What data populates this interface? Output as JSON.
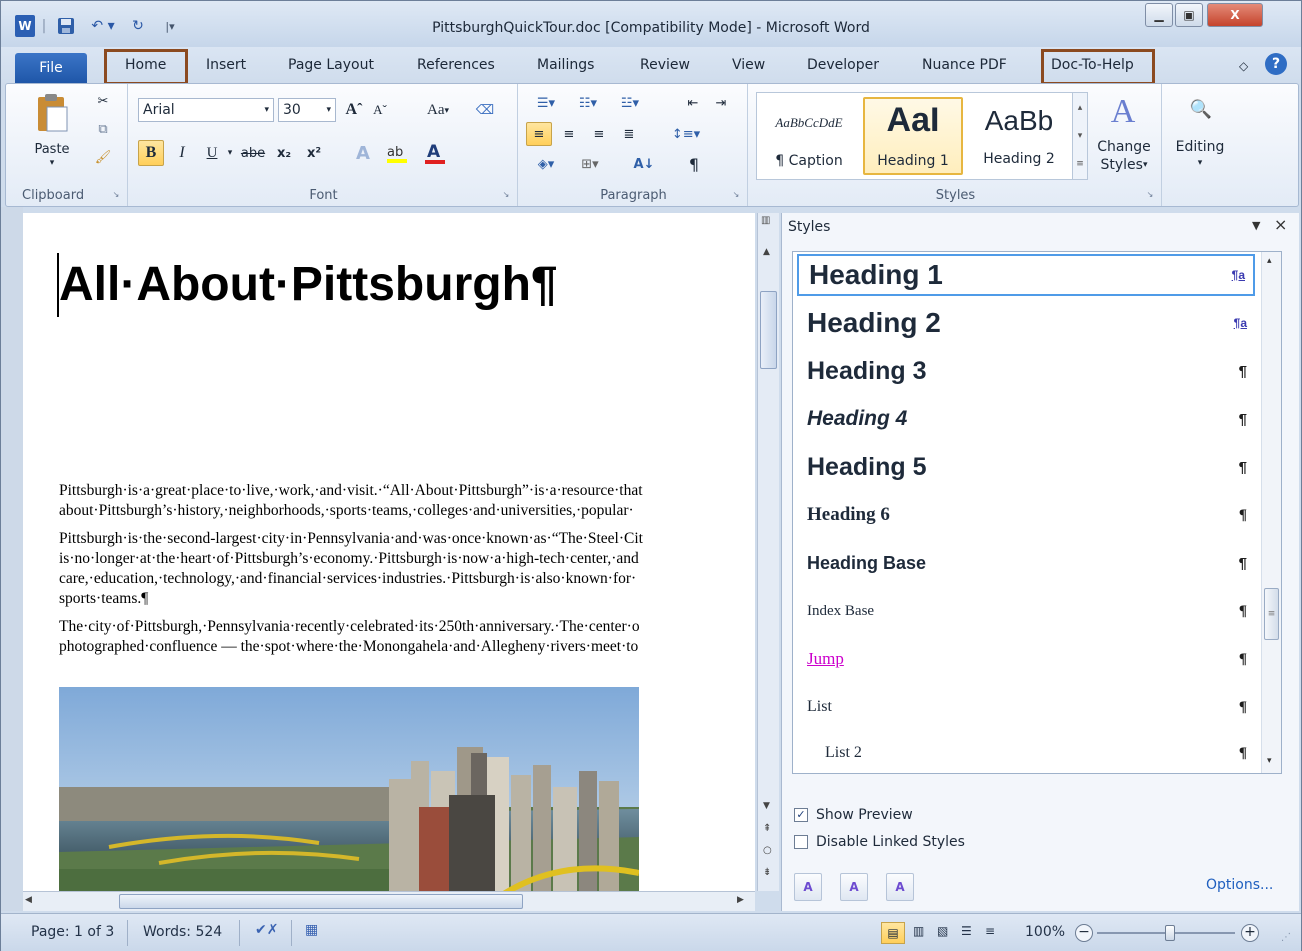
{
  "window": {
    "title": "PittsburghQuickTour.doc [Compatibility Mode] - Microsoft Word",
    "app_badge": "W"
  },
  "tabs": {
    "file": "File",
    "home": "Home",
    "insert": "Insert",
    "page_layout": "Page Layout",
    "references": "References",
    "mailings": "Mailings",
    "review": "Review",
    "view": "View",
    "developer": "Developer",
    "nuance_pdf": "Nuance PDF",
    "doc_to_help": "Doc-To-Help"
  },
  "ribbon": {
    "clipboard": {
      "label": "Clipboard",
      "paste": "Paste"
    },
    "font": {
      "label": "Font",
      "name": "Arial",
      "size": "30",
      "case": "Aa",
      "bold": "B",
      "italic": "I",
      "underline": "U",
      "strike": "abe",
      "subscript": "x₂",
      "superscript": "x²"
    },
    "paragraph": {
      "label": "Paragraph",
      "pilcrow": "¶"
    },
    "styles": {
      "label": "Styles",
      "gallery": [
        {
          "preview": "AaBbCcDdE",
          "name": "¶ Caption"
        },
        {
          "preview": "AaI",
          "name": "Heading 1"
        },
        {
          "preview": "AaBb",
          "name": "Heading 2"
        }
      ],
      "change_styles_1": "Change",
      "change_styles_2": "Styles"
    },
    "editing": {
      "label": "Editing"
    }
  },
  "document": {
    "heading": "All·About·Pittsburgh¶",
    "paragraphs": [
      [
        "Pittsburgh·is·a·great·place·to·live,·work,·and·visit.·“All·About·Pittsburgh”·is·a·resource·that",
        "about·Pittsburgh’s·history,·neighborhoods,·sports·teams,·colleges·and·universities,·popular·"
      ],
      [
        "Pittsburgh·is·the·second-largest·city·in·Pennsylvania·and·was·once·known·as·“The·Steel·Cit",
        "is·no·longer·at·the·heart·of·Pittsburgh’s·economy.·Pittsburgh·is·now·a·high-tech·center,·and",
        "care,·education,·technology,·and·financial·services·industries.·Pittsburgh·is·also·known·for·",
        "sports·teams.¶"
      ],
      [
        "The·city·of·Pittsburgh,·Pennsylvania·recently·celebrated·its·250th·anniversary.·The·center·o",
        "photographed·confluence — the·spot·where·the·Monongahela·and·Allegheny·rivers·meet·to"
      ]
    ]
  },
  "styles_pane": {
    "title": "Styles",
    "items": [
      {
        "name": "Heading 1",
        "mark": "¶a"
      },
      {
        "name": "Heading 2",
        "mark": "¶a"
      },
      {
        "name": "Heading 3",
        "mark": "¶"
      },
      {
        "name": "Heading 4",
        "mark": "¶"
      },
      {
        "name": "Heading 5",
        "mark": "¶"
      },
      {
        "name": "Heading 6",
        "mark": "¶"
      },
      {
        "name": "Heading Base",
        "mark": "¶"
      },
      {
        "name": "Index Base",
        "mark": "¶"
      },
      {
        "name": "Jump",
        "mark": "¶"
      },
      {
        "name": "List",
        "mark": "¶"
      },
      {
        "name": "List 2",
        "mark": "¶"
      }
    ],
    "show_preview": "Show Preview",
    "show_preview_checked": true,
    "disable_linked": "Disable Linked Styles",
    "disable_linked_checked": false,
    "options": "Options..."
  },
  "status": {
    "page": "Page: 1 of 3",
    "words": "Words: 524",
    "zoom": "100%"
  },
  "colors": {
    "file_tab": "#2a62b5",
    "highlight_box": "#8b4a20",
    "jump_link": "#cc00cc"
  }
}
